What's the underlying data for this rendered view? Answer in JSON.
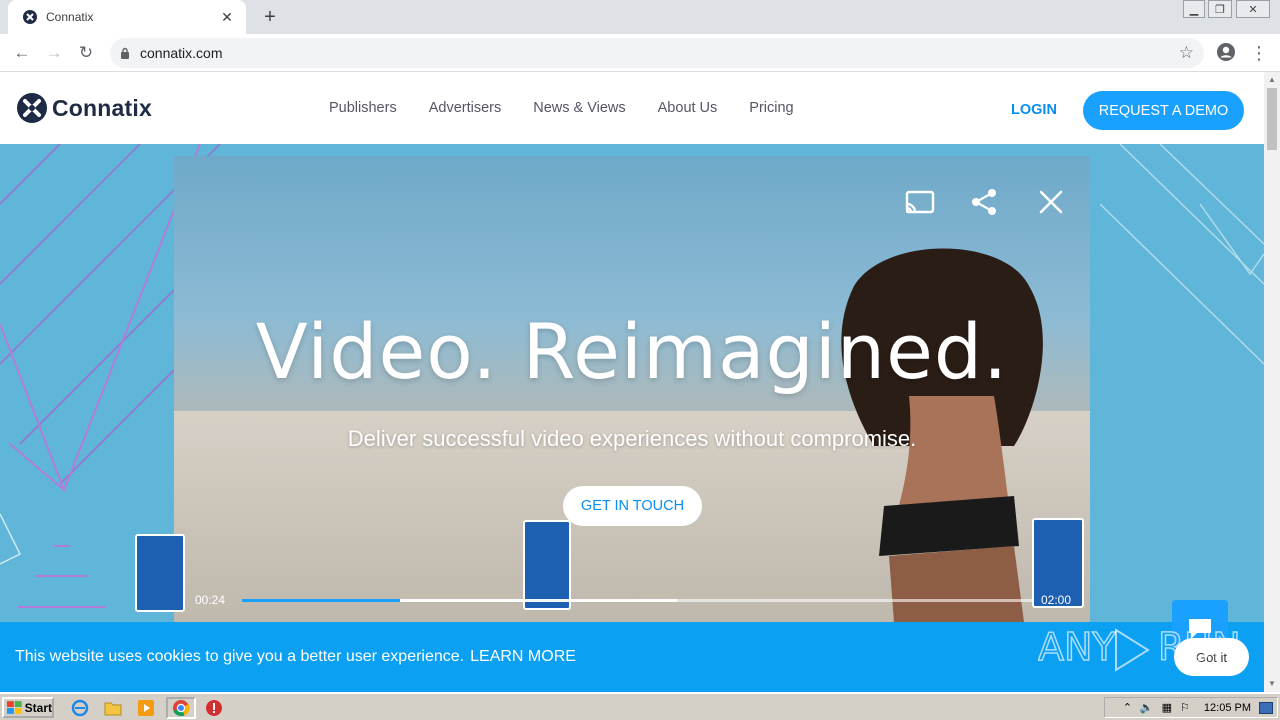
{
  "browser": {
    "tab_title": "Connatix",
    "url": "connatix.com"
  },
  "site": {
    "logo_text": "Connatix",
    "nav": [
      "Publishers",
      "Advertisers",
      "News & Views",
      "About Us",
      "Pricing"
    ],
    "login": "LOGIN",
    "demo_button": "REQUEST A DEMO"
  },
  "hero": {
    "headline": "Video. Reimagined.",
    "subline": "Deliver successful video experiences without compromise.",
    "cta": "GET IN TOUCH"
  },
  "player": {
    "current_time": "00:24",
    "duration": "02:00",
    "progress": 0.2,
    "buffered": 0.55
  },
  "cookie": {
    "text": "This website uses cookies to give you a better user experience.",
    "learn_more": "LEARN MORE",
    "accept": "Got it"
  },
  "watermark": "ANY RUN",
  "taskbar": {
    "start": "Start",
    "clock": "12:05 PM"
  },
  "colors": {
    "accent": "#1aa0ff",
    "cookie_bar": "#0ba0f2",
    "logo_navy": "#1f2a44"
  }
}
